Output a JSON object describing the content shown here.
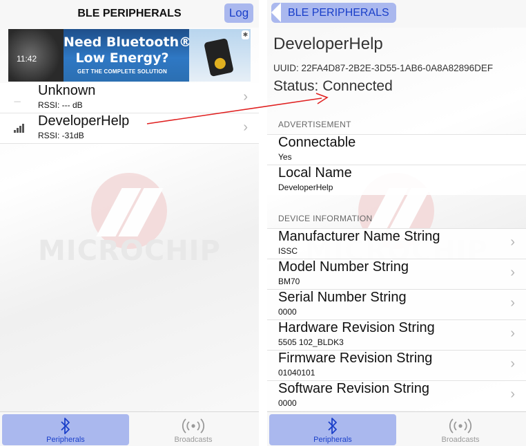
{
  "left": {
    "nav": {
      "title": "BLE PERIPHERALS",
      "log_label": "Log"
    },
    "banner": {
      "headline_line1": "Need Bluetooth®",
      "headline_line2": "Low Energy?",
      "subline": "GET THE COMPLETE SOLUTION",
      "device_time": "11:42"
    },
    "peripherals": [
      {
        "name": "Unknown",
        "rssi": "RSSI: --- dB"
      },
      {
        "name": "DeveloperHelp",
        "rssi": "RSSI: -31dB"
      }
    ],
    "watermark": "MICROCHIP"
  },
  "right": {
    "nav": {
      "back_label": "BLE PERIPHERALS"
    },
    "device": {
      "name": "DeveloperHelp",
      "uuid": "UUID: 22FA4D87-2B2E-3D55-1AB6-0A8A82896DEF",
      "status": "Status: Connected"
    },
    "advertisement": {
      "header": "ADVERTISEMENT",
      "rows": [
        {
          "label": "Connectable",
          "value": "Yes"
        },
        {
          "label": "Local Name",
          "value": "DeveloperHelp"
        }
      ]
    },
    "device_information": {
      "header": "DEVICE INFORMATION",
      "rows": [
        {
          "label": "Manufacturer Name String",
          "value": "ISSC"
        },
        {
          "label": "Model Number String",
          "value": "BM70"
        },
        {
          "label": "Serial Number String",
          "value": "0000"
        },
        {
          "label": "Hardware Revision String",
          "value": "5505 102_BLDK3"
        },
        {
          "label": "Firmware Revision String",
          "value": "01040101"
        },
        {
          "label": "Software Revision String",
          "value": "0000"
        }
      ]
    },
    "watermark": "MICROCHIP"
  },
  "tabs": [
    {
      "label": "Peripherals",
      "icon": "bluetooth-icon",
      "active": true
    },
    {
      "label": "Broadcasts",
      "icon": "broadcast-icon",
      "active": false
    }
  ],
  "colors": {
    "accent": "#1a3fc9",
    "accent_bg": "#aab8ee",
    "annotation_arrow": "#e02020"
  }
}
